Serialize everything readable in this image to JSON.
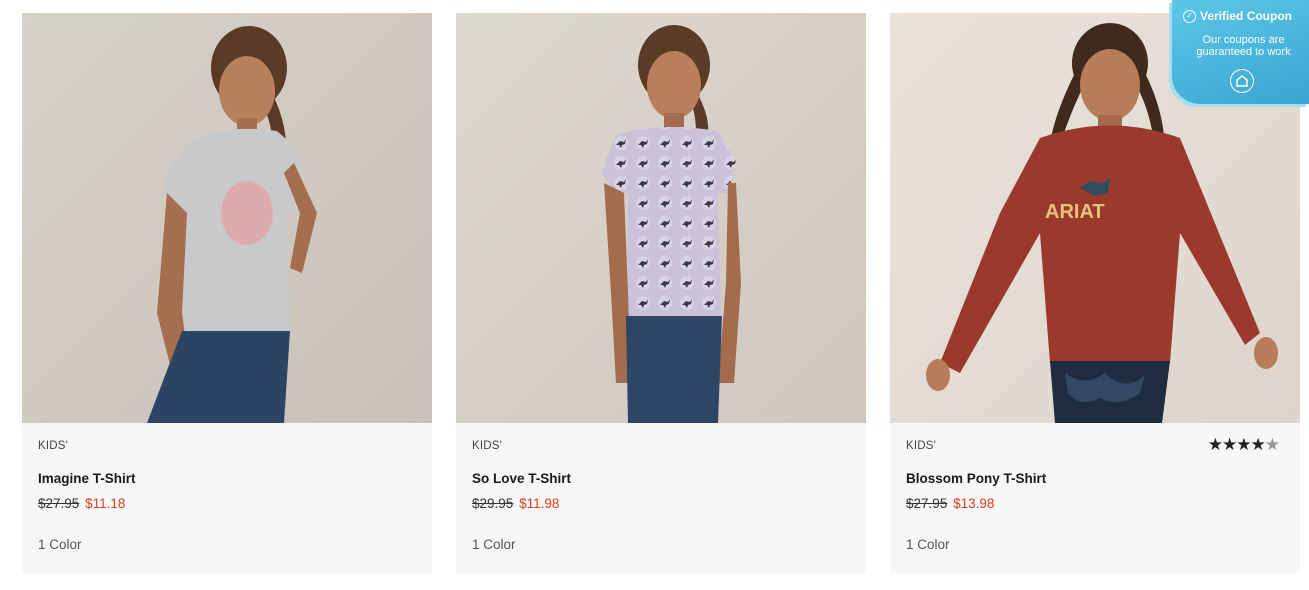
{
  "products": [
    {
      "category": "KIDS'",
      "name": "Imagine T-Shirt",
      "old_price": "$27.95",
      "sale_price": "$11.18",
      "colors": "1 Color",
      "image_alt": "girl-grey-tshirt-photo"
    },
    {
      "category": "KIDS'",
      "name": "So Love T-Shirt",
      "old_price": "$29.95",
      "sale_price": "$11.98",
      "colors": "1 Color",
      "image_alt": "girl-lavender-horse-print-tshirt-photo"
    },
    {
      "category": "KIDS'",
      "name": "Blossom Pony T-Shirt",
      "old_price": "$27.95",
      "sale_price": "$13.98",
      "colors": "1 Color",
      "rating": 4,
      "rating_max": 5,
      "image_alt": "girl-red-longsleeve-tshirt-photo"
    }
  ],
  "coupon": {
    "title": "Verified Coupon",
    "subtitle": "Our coupons are guaranteed to work",
    "icon": "check-circle-icon",
    "logo_icon": "coupon-logo-icon"
  },
  "colors": {
    "sale": "#d9401c",
    "card_bg": "#f7f7f7",
    "coupon_bg": "#3aa6d2"
  }
}
